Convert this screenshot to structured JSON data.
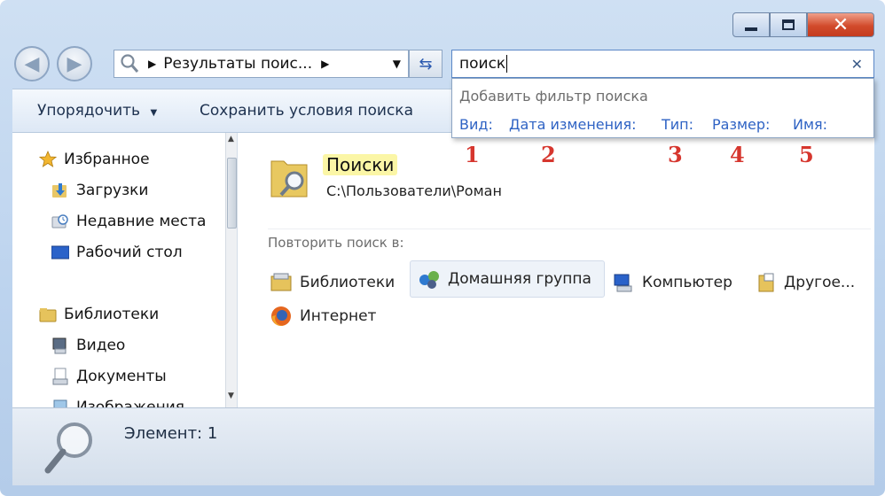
{
  "address": {
    "path": "Результаты поис...",
    "search_value": "поиск"
  },
  "toolbar": {
    "organize_label": "Упорядочить",
    "save_search_label": "Сохранить условия поиска"
  },
  "search_dropdown": {
    "title": "Добавить фильтр поиска",
    "filters": [
      "Вид:",
      "Дата изменения:",
      "Тип:",
      "Размер:",
      "Имя:"
    ],
    "annotations": [
      "1",
      "2",
      "3",
      "4",
      "5"
    ]
  },
  "sidebar": {
    "favorites": {
      "label": "Избранное",
      "items": [
        "Загрузки",
        "Недавние места",
        "Рабочий стол"
      ]
    },
    "libraries": {
      "label": "Библиотеки",
      "items": [
        "Видео",
        "Документы",
        "Изображения"
      ]
    }
  },
  "content": {
    "result": {
      "name": "Поиски",
      "path": "C:\\Пользователи\\Роман"
    },
    "repeat_label": "Повторить поиск в:",
    "locations": [
      "Библиотеки",
      "Домашняя группа",
      "Компьютер",
      "Другое...",
      "Интернет"
    ]
  },
  "status": {
    "text": "Элемент: 1"
  },
  "colors": {
    "accent_link": "#2f63c4",
    "annotation_red": "#d6362e",
    "close_red": "#d24b2c"
  }
}
